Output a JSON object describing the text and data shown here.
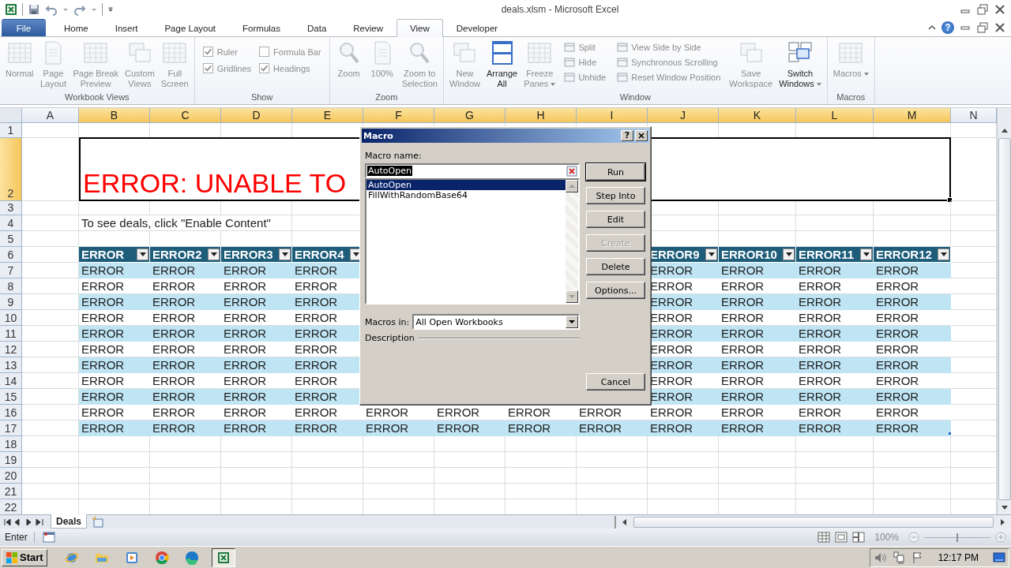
{
  "title_bar": {
    "title": "deals.xlsm  -  Microsoft Excel"
  },
  "ribbon_tabs": [
    {
      "label": "File",
      "kind": "file",
      "selected": false
    },
    {
      "label": "Home",
      "kind": "tab",
      "selected": false
    },
    {
      "label": "Insert",
      "kind": "tab",
      "selected": false
    },
    {
      "label": "Page Layout",
      "kind": "tab",
      "selected": false
    },
    {
      "label": "Formulas",
      "kind": "tab",
      "selected": false
    },
    {
      "label": "Data",
      "kind": "tab",
      "selected": false
    },
    {
      "label": "Review",
      "kind": "tab",
      "selected": false
    },
    {
      "label": "View",
      "kind": "tab",
      "selected": true
    },
    {
      "label": "Developer",
      "kind": "tab",
      "selected": false
    }
  ],
  "help_button": {
    "label": "?"
  },
  "ribbon_groups": [
    {
      "label": "Workbook Views",
      "items": [
        {
          "kind": "large",
          "lines": [
            "Normal"
          ],
          "disabled": true
        },
        {
          "kind": "large",
          "lines": [
            "Page",
            "Layout"
          ],
          "disabled": true
        },
        {
          "kind": "large",
          "lines": [
            "Page Break",
            "Preview"
          ],
          "disabled": true
        },
        {
          "kind": "large",
          "lines": [
            "Custom",
            "Views"
          ],
          "disabled": true
        },
        {
          "kind": "large",
          "lines": [
            "Full",
            "Screen"
          ],
          "disabled": true
        }
      ]
    },
    {
      "label": "Show",
      "items": [
        {
          "kind": "check",
          "label": "Ruler",
          "checked": true,
          "disabled": true
        },
        {
          "kind": "check",
          "label": "Formula Bar",
          "checked": false,
          "disabled": true
        },
        {
          "kind": "check",
          "label": "Gridlines",
          "checked": true,
          "disabled": true
        },
        {
          "kind": "check",
          "label": "Headings",
          "checked": true,
          "disabled": true
        }
      ]
    },
    {
      "label": "Zoom",
      "items": [
        {
          "kind": "large",
          "lines": [
            "Zoom"
          ],
          "disabled": true
        },
        {
          "kind": "large",
          "lines": [
            "100%"
          ],
          "disabled": true
        },
        {
          "kind": "large",
          "lines": [
            "Zoom to",
            "Selection"
          ],
          "disabled": true
        }
      ]
    },
    {
      "label": "Window",
      "items": [
        {
          "kind": "large",
          "lines": [
            "New",
            "Window"
          ],
          "disabled": true
        },
        {
          "kind": "large",
          "lines": [
            "Arrange",
            "All"
          ],
          "disabled": false
        },
        {
          "kind": "large",
          "lines": [
            "Freeze",
            "Panes"
          ],
          "disabled": true,
          "dropdown": true
        },
        {
          "kind": "stack",
          "items": [
            {
              "label": "Split",
              "disabled": true
            },
            {
              "label": "Hide",
              "disabled": true
            },
            {
              "label": "Unhide",
              "disabled": true
            }
          ]
        },
        {
          "kind": "stack",
          "items": [
            {
              "label": "View Side by Side",
              "disabled": true
            },
            {
              "label": "Synchronous Scrolling",
              "disabled": true
            },
            {
              "label": "Reset Window Position",
              "disabled": true
            }
          ]
        },
        {
          "kind": "large",
          "lines": [
            "Save",
            "Workspace"
          ],
          "disabled": true
        },
        {
          "kind": "large",
          "lines": [
            "Switch",
            "Windows"
          ],
          "disabled": false,
          "dropdown": true
        }
      ]
    },
    {
      "label": "Macros",
      "items": [
        {
          "kind": "large",
          "lines": [
            "Macros"
          ],
          "disabled": true,
          "dropdown": true
        }
      ]
    }
  ],
  "sheet": {
    "columns": [
      {
        "label": "A",
        "selected": false
      },
      {
        "label": "B",
        "selected": true
      },
      {
        "label": "C",
        "selected": true
      },
      {
        "label": "D",
        "selected": true
      },
      {
        "label": "E",
        "selected": true
      },
      {
        "label": "F",
        "selected": true
      },
      {
        "label": "G",
        "selected": true
      },
      {
        "label": "H",
        "selected": true
      },
      {
        "label": "I",
        "selected": true
      },
      {
        "label": "J",
        "selected": true
      },
      {
        "label": "K",
        "selected": true
      },
      {
        "label": "L",
        "selected": true
      },
      {
        "label": "M",
        "selected": true
      },
      {
        "label": "N",
        "selected": false
      }
    ],
    "rows": [
      {
        "label": "1",
        "selected": false
      },
      {
        "label": "2",
        "selected": true
      },
      {
        "label": "3",
        "selected": false
      },
      {
        "label": "4",
        "selected": false
      },
      {
        "label": "5",
        "selected": false
      },
      {
        "label": "6",
        "selected": false
      },
      {
        "label": "7",
        "selected": false
      },
      {
        "label": "8",
        "selected": false
      },
      {
        "label": "9",
        "selected": false
      },
      {
        "label": "10",
        "selected": false
      },
      {
        "label": "11",
        "selected": false
      },
      {
        "label": "12",
        "selected": false
      },
      {
        "label": "13",
        "selected": false
      },
      {
        "label": "14",
        "selected": false
      },
      {
        "label": "15",
        "selected": false
      },
      {
        "label": "16",
        "selected": false
      },
      {
        "label": "17",
        "selected": false
      },
      {
        "label": "18",
        "selected": false
      },
      {
        "label": "19",
        "selected": false
      },
      {
        "label": "20",
        "selected": false
      },
      {
        "label": "21",
        "selected": false
      },
      {
        "label": "22",
        "selected": false
      }
    ],
    "title_cell": "ERROR: UNABLE TO",
    "note_cell": "To see deals, click \"Enable Content\"",
    "table": {
      "header": {
        "left": [
          "ERROR",
          "ERROR2",
          "ERROR3",
          "ERROR4"
        ],
        "right": [
          "ERROR9",
          "ERROR10",
          "ERROR11",
          "ERROR12"
        ]
      },
      "rows": [
        {
          "left": [
            "ERROR",
            "ERROR",
            "ERROR",
            "ERROR"
          ],
          "right": [
            "ERROR",
            "ERROR",
            "ERROR",
            "ERROR"
          ]
        },
        {
          "left": [
            "ERROR",
            "ERROR",
            "ERROR",
            "ERROR"
          ],
          "right": [
            "ERROR",
            "ERROR",
            "ERROR",
            "ERROR"
          ]
        },
        {
          "left": [
            "ERROR",
            "ERROR",
            "ERROR",
            "ERROR"
          ],
          "right": [
            "ERROR",
            "ERROR",
            "ERROR",
            "ERROR"
          ]
        },
        {
          "left": [
            "ERROR",
            "ERROR",
            "ERROR",
            "ERROR"
          ],
          "right": [
            "ERROR",
            "ERROR",
            "ERROR",
            "ERROR"
          ]
        },
        {
          "left": [
            "ERROR",
            "ERROR",
            "ERROR",
            "ERROR"
          ],
          "right": [
            "ERROR",
            "ERROR",
            "ERROR",
            "ERROR"
          ]
        },
        {
          "left": [
            "ERROR",
            "ERROR",
            "ERROR",
            "ERROR"
          ],
          "right": [
            "ERROR",
            "ERROR",
            "ERROR",
            "ERROR"
          ]
        },
        {
          "left": [
            "ERROR",
            "ERROR",
            "ERROR",
            "ERROR"
          ],
          "right": [
            "ERROR",
            "ERROR",
            "ERROR",
            "ERROR"
          ]
        },
        {
          "left": [
            "ERROR",
            "ERROR",
            "ERROR",
            "ERROR"
          ],
          "right": [
            "ERROR",
            "ERROR",
            "ERROR",
            "ERROR"
          ]
        },
        {
          "left": [
            "ERROR",
            "ERROR",
            "ERROR",
            "ERROR"
          ],
          "right": [
            "ERROR",
            "ERROR",
            "ERROR",
            "ERROR"
          ]
        },
        {
          "left": [
            "ERROR",
            "ERROR",
            "ERROR",
            "ERROR"
          ],
          "middle": [
            "ERROR",
            "ERROR",
            "ERROR",
            "ERROR"
          ],
          "right": [
            "ERROR",
            "ERROR",
            "ERROR",
            "ERROR"
          ]
        },
        {
          "left": [
            "ERROR",
            "ERROR",
            "ERROR",
            "ERROR"
          ],
          "middle": [
            "ERROR",
            "ERROR",
            "ERROR",
            "ERROR"
          ],
          "right": [
            "ERROR",
            "ERROR",
            "ERROR",
            "ERROR"
          ]
        }
      ]
    }
  },
  "sheet_tabs": [
    {
      "label": "Deals",
      "selected": true
    }
  ],
  "status_bar": {
    "mode": "Enter",
    "zoom": "100%",
    "zoom_slider": {
      "level": 0.5
    }
  },
  "dialog": {
    "title": "Macro",
    "help_label": "?",
    "name_label": "Macro name:",
    "name_value": "AutoOpen",
    "macros": [
      {
        "name": "AutoOpen",
        "selected": true
      },
      {
        "name": "FillWithRandomBase64",
        "selected": false
      }
    ],
    "buttons": [
      {
        "label": "Run",
        "default": true,
        "disabled": false
      },
      {
        "label": "Step Into",
        "default": false,
        "disabled": false
      },
      {
        "label": "Edit",
        "default": false,
        "disabled": false
      },
      {
        "label": "Create",
        "default": false,
        "disabled": true
      },
      {
        "label": "Delete",
        "default": false,
        "disabled": false
      },
      {
        "label": "Options...",
        "default": false,
        "disabled": false
      },
      {
        "label": "Cancel",
        "default": false,
        "disabled": false
      }
    ],
    "macros_in_label": "Macros in:",
    "macros_in_value": "All Open Workbooks",
    "description_label": "Description"
  },
  "taskbar": {
    "start": "Start",
    "apps": [
      {
        "active": false
      },
      {
        "active": false
      },
      {
        "active": false
      },
      {
        "active": false
      },
      {
        "active": false
      },
      {
        "active": true
      }
    ],
    "clock": "12:17 PM"
  }
}
